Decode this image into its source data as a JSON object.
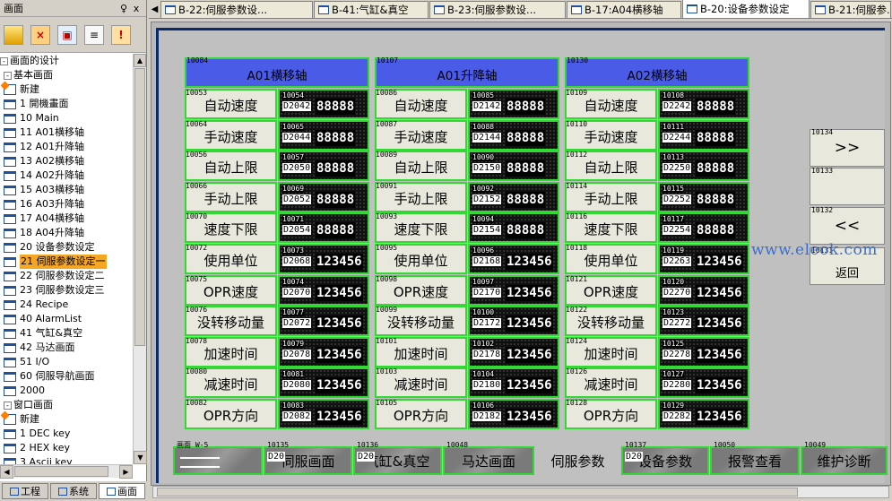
{
  "left_panel": {
    "title": "画面",
    "pin": "♀",
    "close": "x",
    "tree_root": "画面的设计",
    "basic_group": "基本画面",
    "new_label": "新建",
    "basic_items": [
      "1 開機畫面",
      "10 Main",
      "11 A01横移轴",
      "12 A01升降轴",
      "13 A02横移轴",
      "14 A02升降轴",
      "15 A03横移轴",
      "16 A03升降轴",
      "17 A04横移轴",
      "18 A04升降轴",
      "20 设备参数设定",
      "21 伺服参数设定一",
      "22 伺服参数设定二",
      "23 伺服参数设定三",
      "24 Recipe",
      "40 AlarmList",
      "41 气缸&真空",
      "42 马达画面",
      "51 I/O",
      "60 伺服导航画面",
      "2000"
    ],
    "selected_item": "21 伺服参数设定一",
    "window_group": "窗口画面",
    "window_new_label": "新建",
    "window_items": [
      "1 DEC key",
      "2 HEX key",
      "3 Ascii key"
    ],
    "tabs": [
      "工程",
      "系统",
      "画面"
    ],
    "active_tab": "画面"
  },
  "doc_tabs": [
    {
      "label": "B-22:伺服参数设..."
    },
    {
      "label": "B-41:气缸&真空"
    },
    {
      "label": "B-23:伺服参数设..."
    },
    {
      "label": "B-17:A04横移轴"
    },
    {
      "label": "B-20:设备参数设定",
      "active": true
    },
    {
      "label": "B-21:伺服参..."
    }
  ],
  "columns": [
    {
      "header_id": "10084",
      "header": "A01横移轴",
      "rows": [
        {
          "lid": "10053",
          "label": "自动速度",
          "vid": "10054",
          "reg": "D2042",
          "val": "88888"
        },
        {
          "lid": "10064",
          "label": "手动速度",
          "vid": "10065",
          "reg": "D2044",
          "val": "88888"
        },
        {
          "lid": "10056",
          "label": "自动上限",
          "vid": "10057",
          "reg": "D2050",
          "val": "88888"
        },
        {
          "lid": "10066",
          "label": "手动上限",
          "vid": "10069",
          "reg": "D2052",
          "val": "88888"
        },
        {
          "lid": "10070",
          "label": "速度下限",
          "vid": "10071",
          "reg": "D2054",
          "val": "88888"
        },
        {
          "lid": "10072",
          "label": "使用单位",
          "vid": "10073",
          "reg": "D2068",
          "val": "123456"
        },
        {
          "lid": "10075",
          "label": "OPR速度",
          "vid": "10074",
          "reg": "D2070",
          "val": "123456"
        },
        {
          "lid": "10076",
          "label": "没转移动量",
          "vid": "10077",
          "reg": "D2072",
          "val": "123456"
        },
        {
          "lid": "10078",
          "label": "加速时间",
          "vid": "10079",
          "reg": "D2078",
          "val": "123456"
        },
        {
          "lid": "10080",
          "label": "减速时间",
          "vid": "10081",
          "reg": "D2080",
          "val": "123456"
        },
        {
          "lid": "10082",
          "label": "OPR方向",
          "vid": "10083",
          "reg": "D2082",
          "val": "123456"
        }
      ]
    },
    {
      "header_id": "10107",
      "header": "A01升降轴",
      "rows": [
        {
          "lid": "10086",
          "label": "自动速度",
          "vid": "10085",
          "reg": "D2142",
          "val": "88888"
        },
        {
          "lid": "10087",
          "label": "手动速度",
          "vid": "10088",
          "reg": "D2144",
          "val": "88888"
        },
        {
          "lid": "10089",
          "label": "自动上限",
          "vid": "10090",
          "reg": "D2150",
          "val": "88888"
        },
        {
          "lid": "10091",
          "label": "手动上限",
          "vid": "10092",
          "reg": "D2152",
          "val": "88888"
        },
        {
          "lid": "10093",
          "label": "速度下限",
          "vid": "10094",
          "reg": "D2154",
          "val": "88888"
        },
        {
          "lid": "10095",
          "label": "使用单位",
          "vid": "10096",
          "reg": "D2168",
          "val": "123456"
        },
        {
          "lid": "10098",
          "label": "OPR速度",
          "vid": "10097",
          "reg": "D2170",
          "val": "123456"
        },
        {
          "lid": "10099",
          "label": "没转移动量",
          "vid": "10100",
          "reg": "D2172",
          "val": "123456"
        },
        {
          "lid": "10101",
          "label": "加速时间",
          "vid": "10102",
          "reg": "D2178",
          "val": "123456"
        },
        {
          "lid": "10103",
          "label": "减速时间",
          "vid": "10104",
          "reg": "D2180",
          "val": "123456"
        },
        {
          "lid": "10105",
          "label": "OPR方向",
          "vid": "10106",
          "reg": "D2182",
          "val": "123456"
        }
      ]
    },
    {
      "header_id": "10130",
      "header": "A02横移轴",
      "rows": [
        {
          "lid": "10109",
          "label": "自动速度",
          "vid": "10108",
          "reg": "D2242",
          "val": "88888"
        },
        {
          "lid": "10110",
          "label": "手动速度",
          "vid": "10111",
          "reg": "D2244",
          "val": "88888"
        },
        {
          "lid": "10112",
          "label": "自动上限",
          "vid": "10113",
          "reg": "D2250",
          "val": "88888"
        },
        {
          "lid": "10114",
          "label": "手动上限",
          "vid": "10115",
          "reg": "D2252",
          "val": "88888"
        },
        {
          "lid": "10116",
          "label": "速度下限",
          "vid": "10117",
          "reg": "D2254",
          "val": "88888"
        },
        {
          "lid": "10118",
          "label": "使用单位",
          "vid": "10119",
          "reg": "D2263",
          "val": "123456"
        },
        {
          "lid": "10121",
          "label": "OPR速度",
          "vid": "10120",
          "reg": "D2270",
          "val": "123456"
        },
        {
          "lid": "10122",
          "label": "没转移动量",
          "vid": "10123",
          "reg": "D2272",
          "val": "123456"
        },
        {
          "lid": "10124",
          "label": "加速时间",
          "vid": "10125",
          "reg": "D2278",
          "val": "123456"
        },
        {
          "lid": "10126",
          "label": "减速时间",
          "vid": "10127",
          "reg": "D2280",
          "val": "123456"
        },
        {
          "lid": "10128",
          "label": "OPR方向",
          "vid": "10129",
          "reg": "D2282",
          "val": "123456"
        }
      ]
    }
  ],
  "side_buttons": [
    {
      "id": "10134",
      "label": ">>"
    },
    {
      "id": "10133",
      "label": ""
    },
    {
      "id": "10132",
      "label": "<<"
    },
    {
      "id": "10131",
      "label": "返回"
    }
  ],
  "bottom_buttons": [
    {
      "id": "画面 W-5",
      "reg": "",
      "label": ""
    },
    {
      "id": "10135",
      "reg": "D20",
      "label": "伺服画面"
    },
    {
      "id": "10136",
      "reg": "D20",
      "label": "气缸&真空"
    },
    {
      "id": "10048",
      "reg": "",
      "label": "马达画面"
    },
    {
      "id": "",
      "reg": "",
      "label": "伺服参数"
    },
    {
      "id": "10137",
      "reg": "D20",
      "label": "设备参数"
    },
    {
      "id": "10050",
      "reg": "",
      "label": "报警查看"
    },
    {
      "id": "10049",
      "reg": "",
      "label": "维护诊断"
    }
  ],
  "watermark": "www.eleok.com",
  "colors": {
    "header_blue": "#4a5be8",
    "frame_green": "#34d834",
    "selection_orange": "#f5a623"
  }
}
